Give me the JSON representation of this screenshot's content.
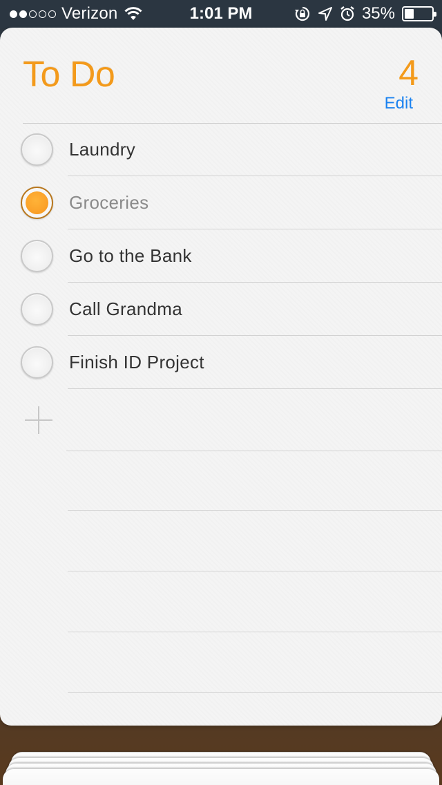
{
  "status_bar": {
    "carrier": "Verizon",
    "signal_bars_on": 2,
    "signal_bars_total": 5,
    "time": "1:01 PM",
    "battery_percent": "35%",
    "battery_level": 0.35
  },
  "list": {
    "title": "To Do",
    "count": "4",
    "edit_label": "Edit",
    "accent_color": "#f39a1b",
    "link_color": "#1a82f0",
    "items": [
      {
        "label": "Laundry",
        "completed": false
      },
      {
        "label": "Groceries",
        "completed": true
      },
      {
        "label": "Go to the Bank",
        "completed": false
      },
      {
        "label": "Call Grandma",
        "completed": false
      },
      {
        "label": "Finish ID Project",
        "completed": false
      }
    ],
    "add_icon": "plus-icon"
  },
  "icons": {
    "wifi": "wifi-icon",
    "rotation_lock": "rotation-lock-icon",
    "location": "location-arrow-icon",
    "alarm": "alarm-clock-icon",
    "battery": "battery-icon"
  }
}
